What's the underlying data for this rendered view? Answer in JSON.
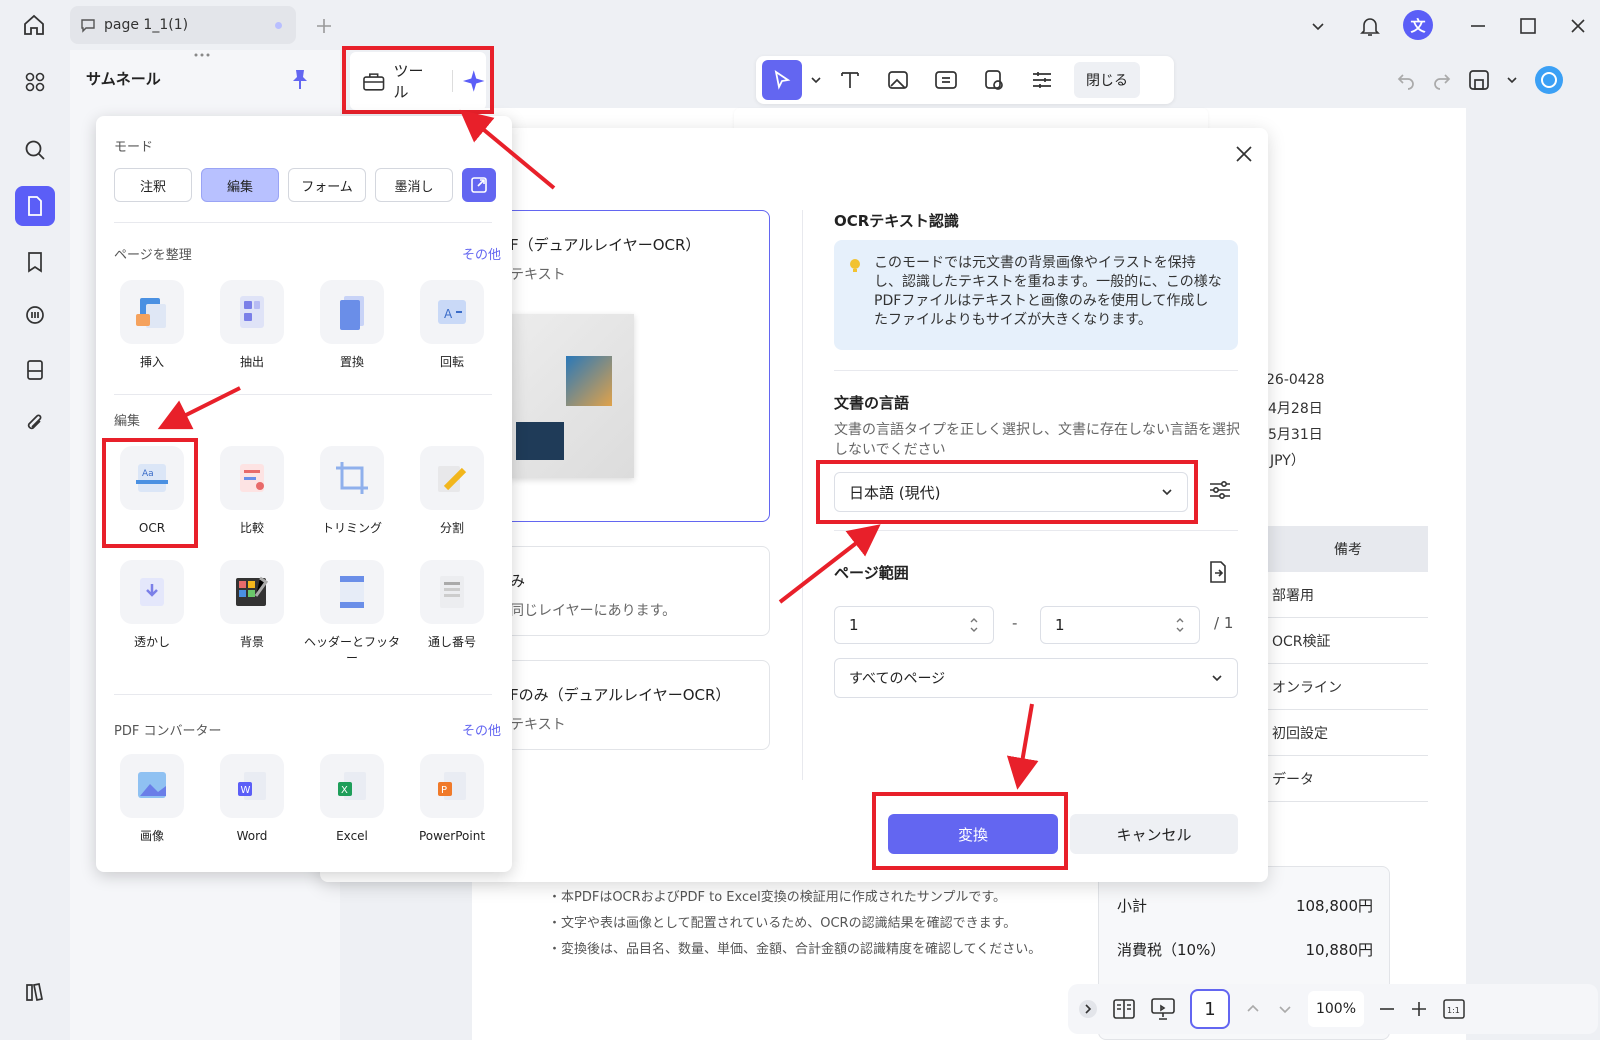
{
  "titlebar": {
    "tab_label": "page 1_1(1)",
    "avatar_char": "文"
  },
  "thumbnail_panel": {
    "title": "サムネール"
  },
  "toolbar": {
    "tools_label": "ツール",
    "close_label": "閉じる"
  },
  "tools_popup": {
    "mode_label": "モード",
    "modes": [
      "注釈",
      "編集",
      "フォーム",
      "墨消し"
    ],
    "organize_label": "ページを整理",
    "more_label": "その他",
    "organize_tools": [
      "挿入",
      "抽出",
      "置換",
      "回転"
    ],
    "edit_label": "編集",
    "edit_tools": [
      "OCR",
      "比較",
      "トリミング",
      "分割",
      "透かし",
      "背景",
      "ヘッダーとフッター",
      "通し番号"
    ],
    "converter_label": "PDF コンバーター",
    "converter_tools": [
      "画像",
      "Word",
      "Excel",
      "PowerPoint"
    ]
  },
  "ocr_dialog": {
    "option1_title": "F（デュアルレイヤーOCR）",
    "option1_sub": "テキスト",
    "option2_title": "み",
    "option2_sub": "同じレイヤーにあります。",
    "option3_title": "Fのみ（デュアルレイヤーOCR）",
    "option3_sub": "テキスト",
    "ocr_heading": "OCRテキスト認識",
    "info_text": "このモードでは元文書の背景画像やイラストを保持し、認識したテキストを重ねます。一般的に、この様なPDFファイルはテキストと画像のみを使用して作成したファイルよりもサイズが大きくなります。",
    "lang_heading": "文書の言語",
    "lang_desc": "文書の言語タイプを正しく選択し、文書に存在しない言語を選択しないでください",
    "lang_value": "日本語 (現代)",
    "range_heading": "ページ範囲",
    "range_from": "1",
    "range_dash": "-",
    "range_to": "1",
    "range_total": "/ 1",
    "page_select": "すべてのページ",
    "convert_label": "変換",
    "cancel_label": "キャンセル"
  },
  "document": {
    "meta_lines": [
      "26-0428",
      "4月28日",
      "5月31日",
      "JPY）"
    ],
    "remarks_header": "備考",
    "remarks_rows": [
      "部署用",
      "OCR検証",
      "オンライン",
      "初回設定",
      "データ"
    ],
    "notes": [
      "・本PDFはOCRおよびPDF to Excel変換の検証用に作成されたサンプルです。",
      "・文字や表は画像として配置されているため、OCRの認識結果を確認できます。",
      "・変換後は、品目名、数量、単価、金額、合計金額の認識精度を確認してください。"
    ],
    "subtotal_label": "小計",
    "subtotal_value": "108,800円",
    "tax_label": "消費税（10%）",
    "tax_value": "10,880円"
  },
  "bottom_bar": {
    "page": "1",
    "zoom": "100%"
  },
  "colors": {
    "accent": "#6366f1",
    "annotation_red": "#e8202a"
  }
}
